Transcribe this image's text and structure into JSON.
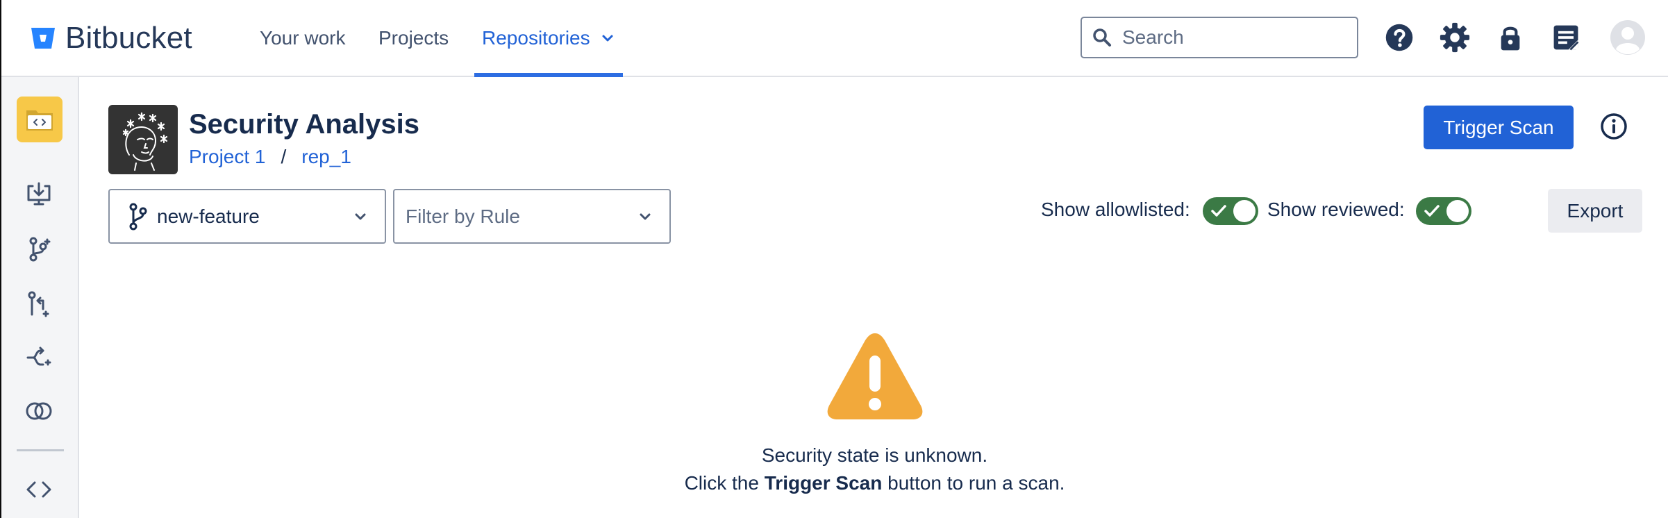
{
  "app": {
    "name": "Bitbucket"
  },
  "nav": {
    "items": [
      {
        "label": "Your work"
      },
      {
        "label": "Projects"
      },
      {
        "label": "Repositories"
      }
    ],
    "active": "Repositories"
  },
  "search": {
    "placeholder": "Search"
  },
  "header_icons": [
    "help-icon",
    "gear-icon",
    "lock-icon",
    "notes-icon",
    "user-avatar"
  ],
  "sidebar": {
    "items": [
      "source-icon",
      "clone-icon",
      "branches-icon",
      "pull-requests-icon",
      "forks-icon",
      "compare-icon",
      "code-icon"
    ]
  },
  "page": {
    "title": "Security Analysis",
    "breadcrumb": {
      "project": "Project 1",
      "separator": "/",
      "repo": "rep_1"
    },
    "trigger_button": "Trigger Scan",
    "branch_select": {
      "value": "new-feature"
    },
    "rule_filter": {
      "placeholder": "Filter by Rule"
    },
    "toggles": {
      "allowlisted": {
        "label": "Show allowlisted:",
        "on": true
      },
      "reviewed": {
        "label": "Show reviewed:",
        "on": true
      }
    },
    "export_button": "Export",
    "empty_state": {
      "line1": "Security state is unknown.",
      "line2_prefix": "Click the ",
      "line2_bold": "Trigger Scan",
      "line2_suffix": " button to run a scan."
    }
  },
  "colors": {
    "accent": "#2162d6",
    "toggle_on": "#3b7a45",
    "warning": "#f2a93b",
    "repo_tile": "#f7c848",
    "text": "#172b4d"
  }
}
